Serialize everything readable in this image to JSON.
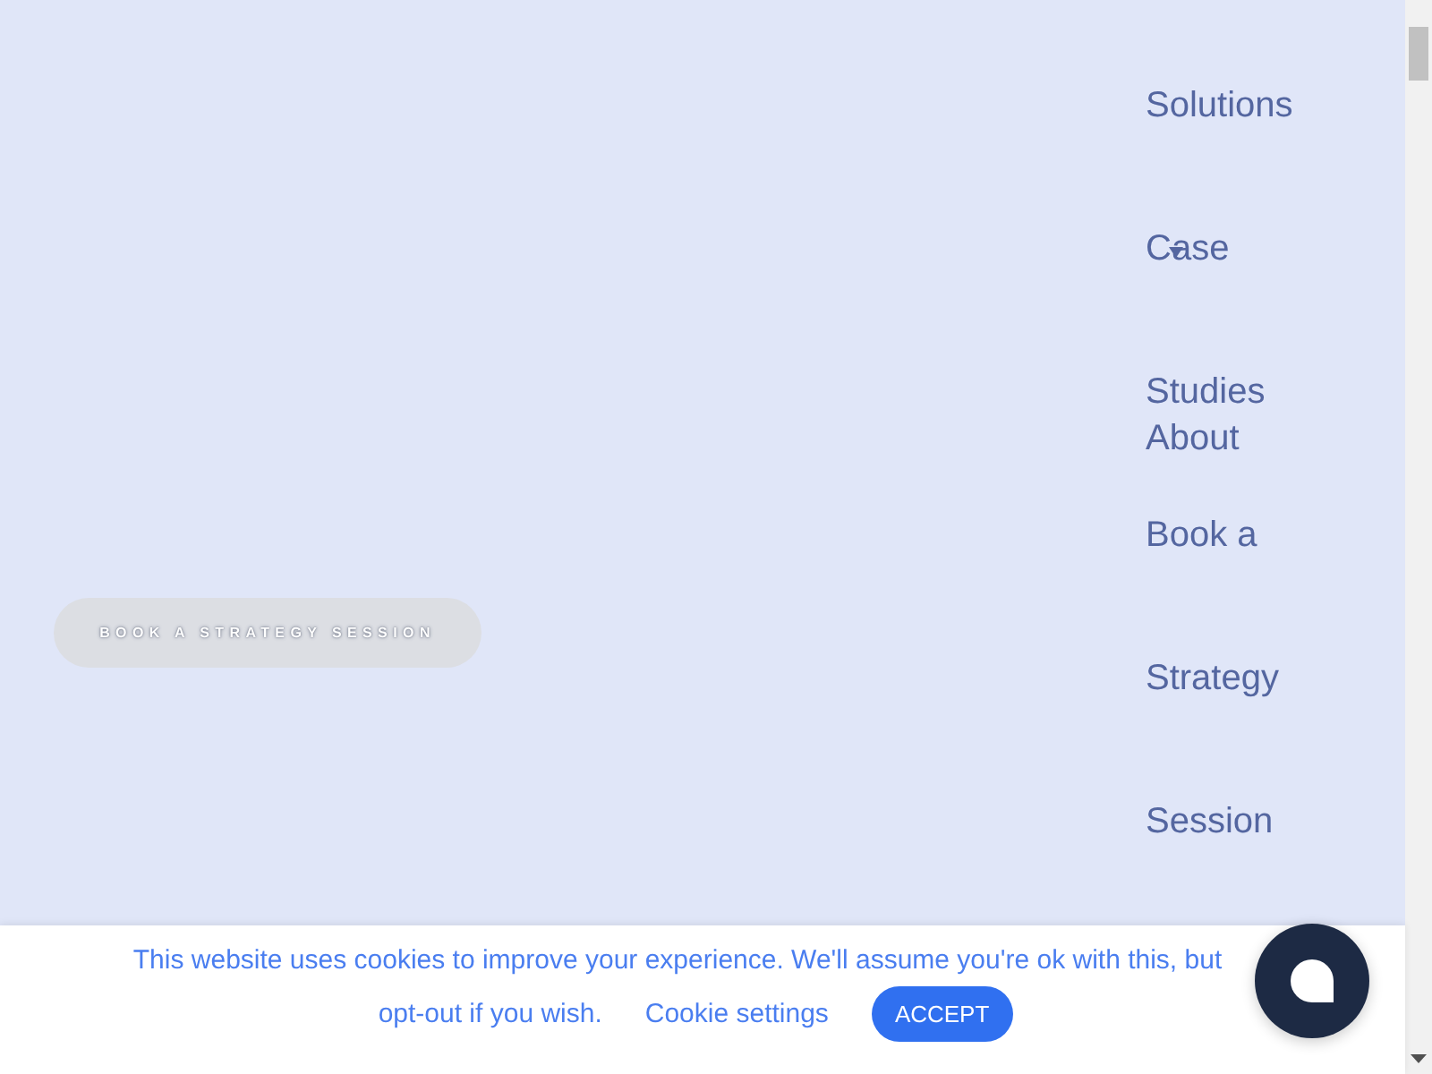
{
  "nav": {
    "items": [
      {
        "label": "Solutions",
        "has_dropdown": false
      },
      {
        "label": "Case Studies",
        "has_dropdown": true
      },
      {
        "label": "About",
        "has_dropdown": false
      },
      {
        "label": "Book a Strategy Session",
        "has_dropdown": false
      }
    ]
  },
  "hero": {
    "cta": "BOOK A STRATEGY SESSION"
  },
  "cookie_bar": {
    "message_line_1": "This website uses cookies to improve your experience. We'll assume you're ok with this, but",
    "message_line_2": "opt-out if you wish.",
    "settings_link": "Cookie settings",
    "accept": "ACCEPT"
  }
}
